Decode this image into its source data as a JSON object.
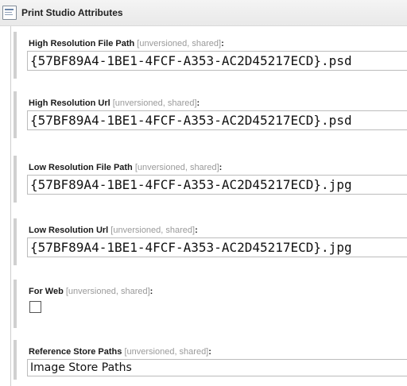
{
  "section": {
    "title": "Print Studio Attributes",
    "icon": "form-section-icon"
  },
  "fields": [
    {
      "label": "High Resolution File Path",
      "meta": "[unversioned, shared]",
      "value": "{57BF89A4-1BE1-4FCF-A353-AC2D45217ECD}.psd"
    },
    {
      "label": "High Resolution Url",
      "meta": "[unversioned, shared]",
      "value": "{57BF89A4-1BE1-4FCF-A353-AC2D45217ECD}.psd"
    },
    {
      "label": "Low Resolution File Path",
      "meta": "[unversioned, shared]",
      "value": "{57BF89A4-1BE1-4FCF-A353-AC2D45217ECD}.jpg"
    },
    {
      "label": "Low Resolution Url",
      "meta": "[unversioned, shared]",
      "value": "{57BF89A4-1BE1-4FCF-A353-AC2D45217ECD}.jpg"
    },
    {
      "label": "For Web",
      "meta": "[unversioned, shared]",
      "checked": false
    },
    {
      "label": "Reference Store Paths",
      "meta": "[unversioned, shared]",
      "value": "Image Store Paths"
    }
  ],
  "colon": ":"
}
